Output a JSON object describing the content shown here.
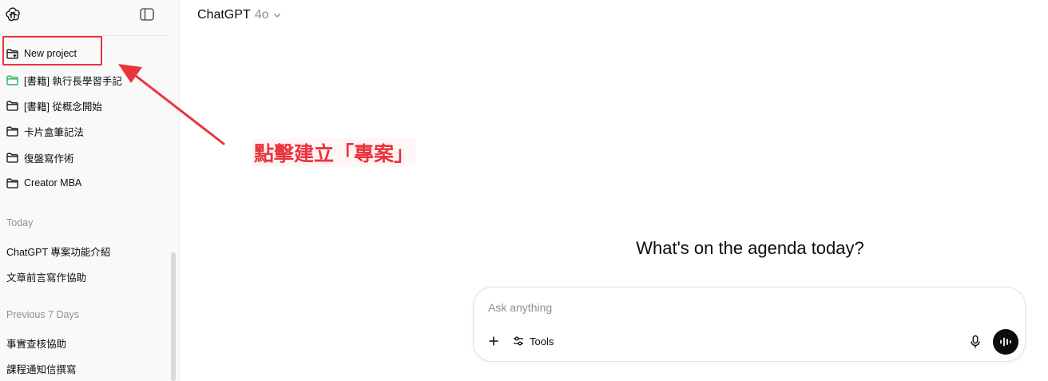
{
  "sidebar": {
    "new_project_label": "New project",
    "projects": [
      "[書籍] 執行長學習手記",
      "[書籍] 從概念開始",
      "卡片盒筆記法",
      "復盤寫作術",
      "Creator MBA"
    ],
    "sections": [
      {
        "title": "Today",
        "chats": [
          "ChatGPT 專案功能介紹",
          "文章前言寫作協助"
        ]
      },
      {
        "title": "Previous 7 Days",
        "chats": [
          "事實查核協助",
          "課程通知信撰寫"
        ]
      }
    ]
  },
  "header": {
    "model_name": "ChatGPT",
    "model_version": "4o"
  },
  "main": {
    "headline": "What's on the agenda today?",
    "composer": {
      "placeholder": "Ask anything",
      "tools_label": "Tools"
    }
  },
  "annotation": {
    "text": "點擊建立「專案」",
    "color": "#e8353d"
  },
  "colors": {
    "accent_green": "#2bb35a",
    "annotation_red": "#e8353d"
  }
}
